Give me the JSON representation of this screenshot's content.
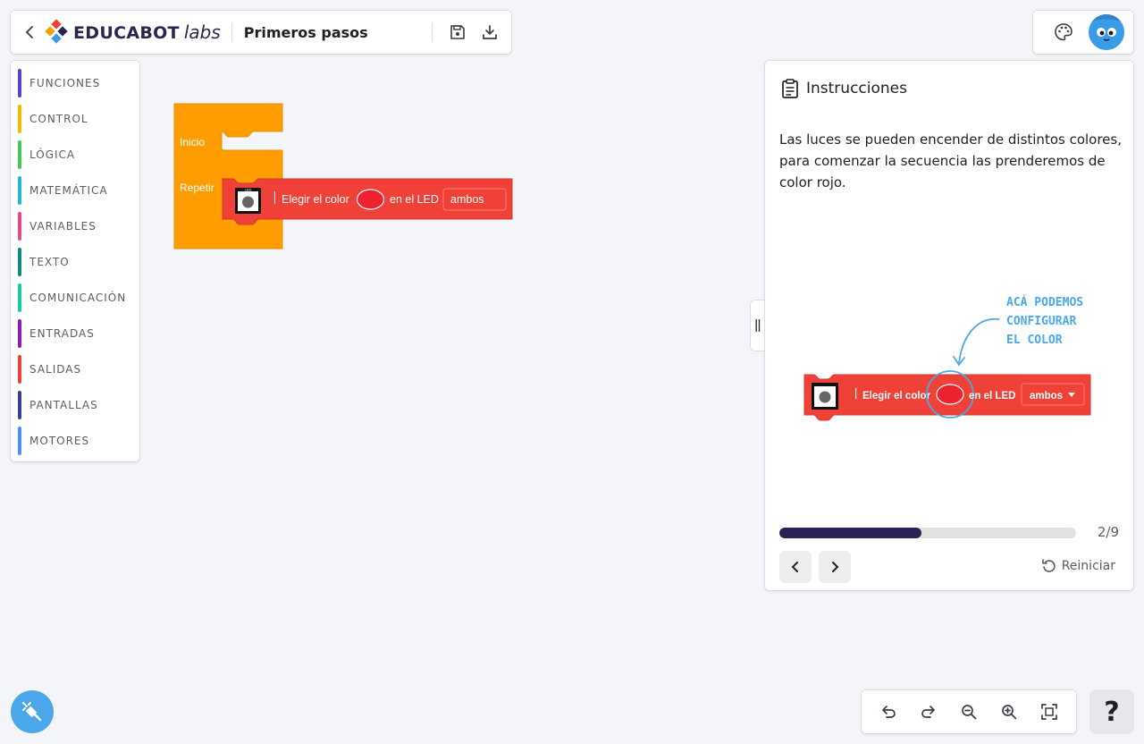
{
  "header": {
    "logo_brand": "EDUCABOT",
    "logo_suffix": "labs",
    "project_title": "Primeros pasos"
  },
  "categories": [
    {
      "label": "FUNCIONES",
      "color": "#5b3fd6"
    },
    {
      "label": "CONTROL",
      "color": "#f5b700"
    },
    {
      "label": "LÓGICA",
      "color": "#4bc45a"
    },
    {
      "label": "MATEMÁTICA",
      "color": "#23b7d0"
    },
    {
      "label": "VARIABLES",
      "color": "#e8478e"
    },
    {
      "label": "TEXTO",
      "color": "#0f8a80"
    },
    {
      "label": "COMUNICACIÓN",
      "color": "#17c9a6"
    },
    {
      "label": "ENTRADAS",
      "color": "#8e1bb5"
    },
    {
      "label": "SALIDAS",
      "color": "#ef4137"
    },
    {
      "label": "PANTALLAS",
      "color": "#3b3d9e"
    },
    {
      "label": "MOTORES",
      "color": "#4d92f0"
    }
  ],
  "workspace": {
    "start_label": "Inicio",
    "repeat_label": "Repetir",
    "led_block": {
      "icon_label": "LED",
      "choose_color_label": "Elegir el color",
      "color_value": "#ee2230",
      "on_led_label": "en el LED",
      "target_value": "ambos"
    }
  },
  "instructions": {
    "title": "Instrucciones",
    "text": "Las luces se pueden encender de distintos colores, para comenzar la secuencia las prenderemos de color rojo.",
    "illustration": {
      "annotation_lines": [
        "ACÁ PODEMOS",
        "CONFIGURAR",
        "EL COLOR"
      ],
      "choose_color_label": "Elegir el color",
      "on_led_label": "en el LED",
      "target_value": "ambos"
    },
    "progress": {
      "current": 2,
      "total": 9,
      "label": "2/9",
      "fraction": 0.48
    },
    "reset_label": "Reiniciar"
  },
  "colors": {
    "accent_orange": "#ff9d00",
    "block_red": "#ef4137",
    "progress_fill": "#2b2358",
    "annotation_blue": "#4aa8ea"
  },
  "help_label": "?"
}
